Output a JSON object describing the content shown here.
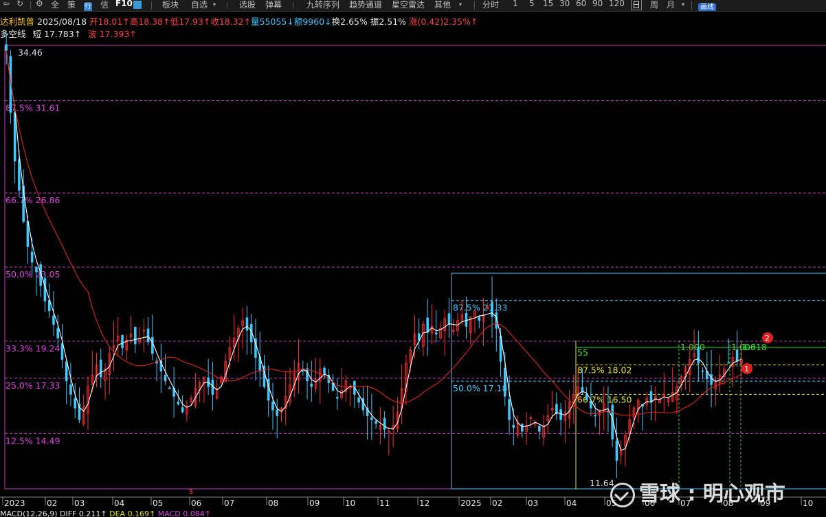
{
  "toolbar": {
    "items": [
      "全",
      "策",
      "行",
      "信",
      "F10",
      "板块",
      "自选",
      "选股",
      "弹幕",
      "九转序列",
      "趋势通道",
      "星空雷达",
      "其他",
      "分时",
      "1",
      "5",
      "15",
      "30",
      "60",
      "90",
      "120",
      "日",
      "周",
      "月",
      "画线"
    ],
    "selected_period": "日"
  },
  "info": {
    "name": "达利凯普",
    "date": "2025/08/18",
    "open": "开18.01↑",
    "high": "高18.38↑",
    "low": "低17.93↑",
    "close": "收18.32↑",
    "volume": "量55055↓",
    "amount": "额9960↓",
    "turnover": "换2.65%",
    "amplitude": "振2.51%",
    "change": "涨(0.42)2.35%↑"
  },
  "indicator": {
    "name": "多空线",
    "short": "短 17.783↑",
    "wave": "波 17.393↑"
  },
  "chart_data": {
    "type": "candlestick",
    "ylim": [
      11.0,
      35.0
    ],
    "x_ticks": [
      "2023",
      "02",
      "03",
      "04",
      "05",
      "06",
      "07",
      "08",
      "09",
      "10",
      "11",
      "12",
      "2025",
      "02",
      "03",
      "04",
      "05",
      "06",
      "07",
      "08",
      "09",
      "10"
    ],
    "fib_left": [
      {
        "label": "34.46",
        "value": 34.46
      },
      {
        "label": "87.5% 31.61",
        "value": 31.61
      },
      {
        "label": "66.7% 26.86",
        "value": 26.86
      },
      {
        "label": "50.0% 23.05",
        "value": 23.05
      },
      {
        "label": "33.3% 19.24",
        "value": 19.24
      },
      {
        "label": "25.0% 17.33",
        "value": 17.33
      },
      {
        "label": "12.5% 14.49",
        "value": 14.49
      }
    ],
    "fib_right": [
      {
        "label": "87.5% 21.33",
        "value": 21.33
      },
      {
        "label": "50.0% 17.18",
        "value": 17.18
      }
    ],
    "fib_recent": [
      {
        "label": "55",
        "value": 19.24
      },
      {
        "label": "87.5% 18.02",
        "value": 18.02
      },
      {
        "label": "66.7% 16.50",
        "value": 16.5
      }
    ],
    "time_markers": [
      "1.000",
      "1.000",
      "1.618"
    ],
    "low_label": "11.64",
    "badges": [
      "1",
      "2"
    ],
    "close_series": [
      34.2,
      31.0,
      28.5,
      27.0,
      25.4,
      24.1,
      23.3,
      22.8,
      22.1,
      21.3,
      20.8,
      20.1,
      19.4,
      18.3,
      17.2,
      16.5,
      15.8,
      15.2,
      15.9,
      16.9,
      17.5,
      18.0,
      17.4,
      17.8,
      18.6,
      19.0,
      19.5,
      18.9,
      19.3,
      19.6,
      19.1,
      19.4,
      19.8,
      19.2,
      18.6,
      18.1,
      17.7,
      17.2,
      16.8,
      16.4,
      16.0,
      15.6,
      15.9,
      16.3,
      16.8,
      17.1,
      17.4,
      16.9,
      16.5,
      16.8,
      17.4,
      18.2,
      18.9,
      19.4,
      19.9,
      20.3,
      19.8,
      19.2,
      18.4,
      17.7,
      16.9,
      16.2,
      15.7,
      15.4,
      15.8,
      16.4,
      17.0,
      17.6,
      18.1,
      17.7,
      17.2,
      16.9,
      17.3,
      17.8,
      17.5,
      17.1,
      16.7,
      16.3,
      16.7,
      17.2,
      16.9,
      16.5,
      16.1,
      15.7,
      15.4,
      15.2,
      15.0,
      14.9,
      14.7,
      14.6,
      14.9,
      15.6,
      16.8,
      18.1,
      18.8,
      19.6,
      19.3,
      20.1,
      19.7,
      20.0,
      19.6,
      19.9,
      20.4,
      20.1,
      19.8,
      20.3,
      20.6,
      20.0,
      20.5,
      20.8,
      20.3,
      20.6,
      21.0,
      20.5,
      19.9,
      18.2,
      16.4,
      15.2,
      14.8,
      15.1,
      14.6,
      14.9,
      15.3,
      15.0,
      14.6,
      14.9,
      15.4,
      15.8,
      15.5,
      15.2,
      15.6,
      16.1,
      16.5,
      16.9,
      16.6,
      16.2,
      15.8,
      15.4,
      15.7,
      16.0,
      15.6,
      14.2,
      13.1,
      13.6,
      14.4,
      15.2,
      15.8,
      16.2,
      15.9,
      16.3,
      16.1,
      16.4,
      16.2,
      16.5,
      16.3,
      16.6,
      16.9,
      17.4,
      17.9,
      18.3,
      18.6,
      18.1,
      17.7,
      17.3,
      17.0,
      17.2,
      17.5,
      17.8,
      18.1,
      18.4,
      18.2,
      18.3
    ]
  },
  "bottom": {
    "macd": "MACD(12,26,9)",
    "diff": "DIFF 0.211↑",
    "dea": "DEA 0.169↑",
    "macd_val": "MACD 0.084↑"
  },
  "watermark": {
    "text": "雪球 : 明心观市"
  }
}
